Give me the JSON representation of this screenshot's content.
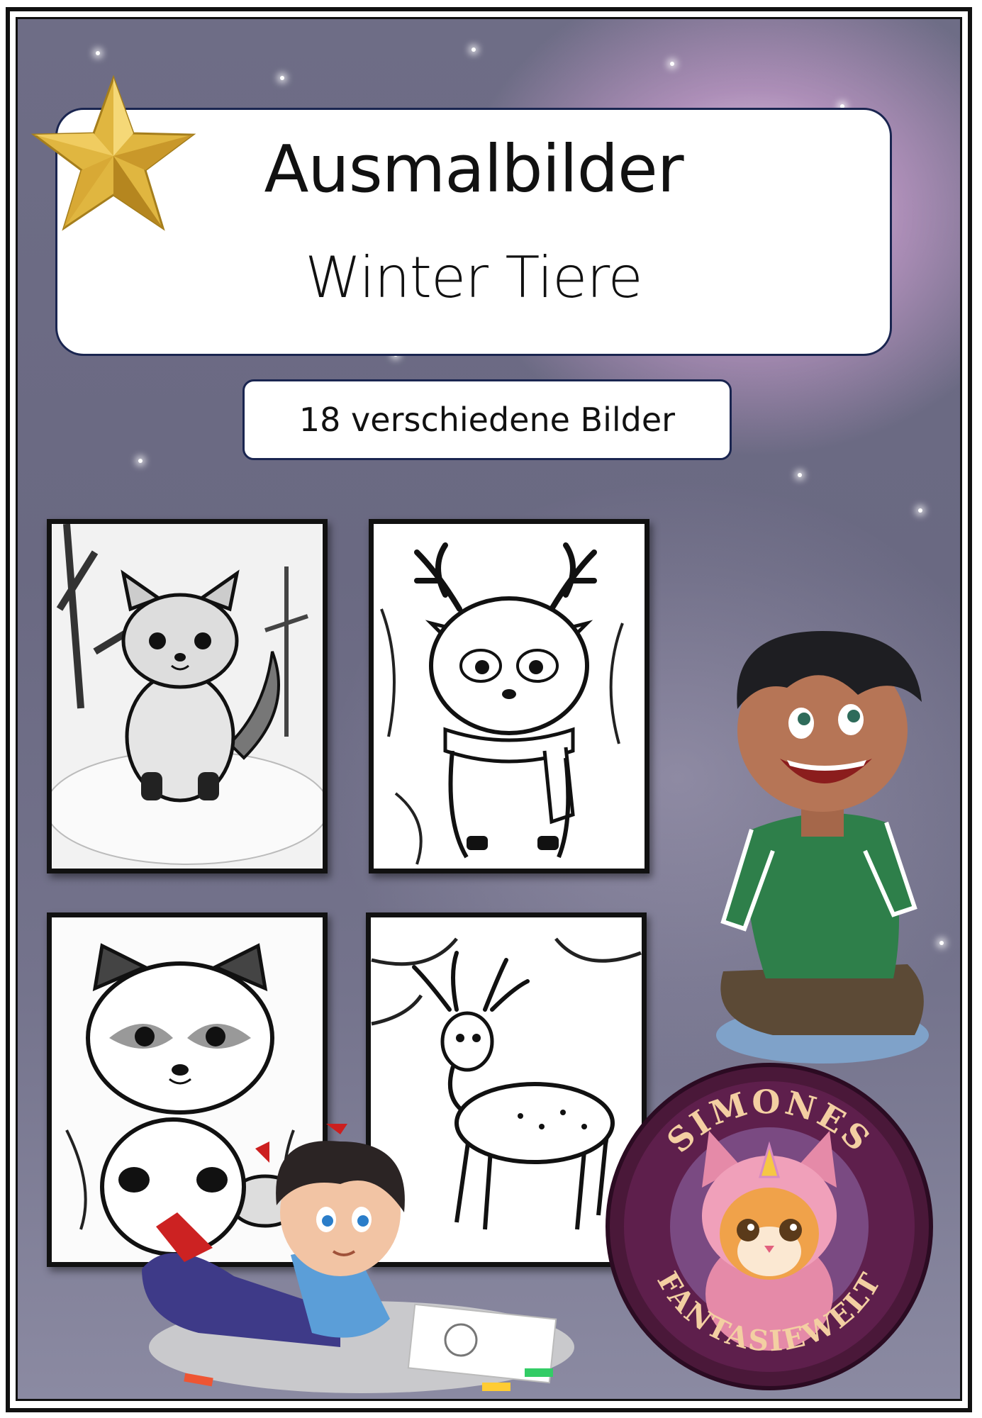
{
  "cover": {
    "title": "Ausmalbilder",
    "subtitle": "Winter Tiere",
    "count_label": "18 verschiedene Bilder"
  },
  "preview_cards": [
    {
      "animal": "fox"
    },
    {
      "animal": "reindeer-with-scarf"
    },
    {
      "animal": "raccoon"
    },
    {
      "animal": "deer"
    }
  ],
  "brand": {
    "badge_top_text": "SIMONES",
    "badge_bottom_text": "FANTASIEWELT"
  },
  "colors": {
    "frame": "#111111",
    "box_border": "#1a2550",
    "star_gold": "#e0b640",
    "badge_purple": "#5e1f4c",
    "badge_text": "#f3cfa2"
  }
}
